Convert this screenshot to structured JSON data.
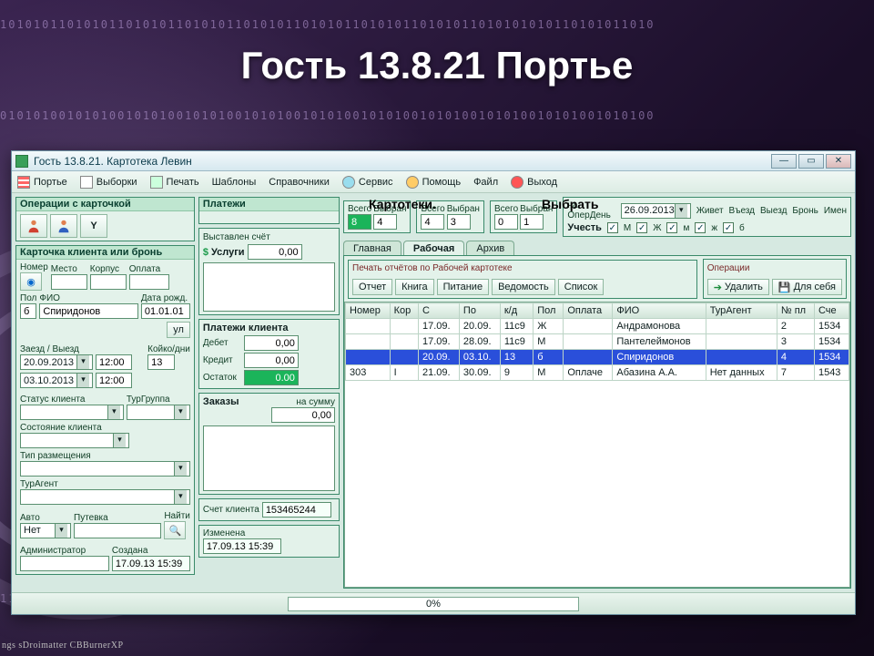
{
  "slide_title": "Гость 13.8.21 Портье",
  "window_title": "Гость 13.8.21. Картотека Левин",
  "menu": {
    "porte": "Портье",
    "vybor": "Выборки",
    "print": "Печать",
    "tmpl": "Шаблоны",
    "dir": "Справочники",
    "serv": "Сервис",
    "help": "Помощь",
    "file": "Файл",
    "exit": "Выход"
  },
  "overlay": {
    "karto": "Картотеки.",
    "choose": "Выбрать"
  },
  "ops_card_caption": "Операции с карточкой",
  "client_card_caption": "Карточка клиента или бронь",
  "payments_caption": "Платежи",
  "card": {
    "nomer": "Номер",
    "mesto": "Место",
    "korpus": "Корпус",
    "oplata": "Оплата",
    "pol": "Пол",
    "fio": "ФИО",
    "dob": "Дата рожд.",
    "pol_val": "б",
    "fio_val": "Спиридонов",
    "dob_val": "01.01.01",
    "zaezd": "Заезд / Выезд",
    "koiko": "Койко/дни",
    "zaezd_date": "20.09.2013",
    "zaezd_time": "12:00",
    "vyezd_date": "03.10.2013",
    "vyezd_time": "12:00",
    "koiko_val": "13",
    "status": "Статус клиента",
    "turg": "ТурГруппа",
    "sost": "Состояние клиента",
    "tip": "Тип размещения",
    "agent": "ТурАгент",
    "avto": "Авто",
    "put": "Путевка",
    "find": "Найти",
    "avto_val": "Нет",
    "admin": "Администратор",
    "created": "Создана",
    "created_val": "17.09.13 15:39",
    "changed": "Изменена",
    "changed_val": "17.09.13 15:39"
  },
  "pay": {
    "bill": "Выставлен счёт",
    "uslugi": "Услуги",
    "uslugi_val": "0,00",
    "client": "Платежи клиента",
    "debet": "Дебет",
    "debet_val": "0,00",
    "kredit": "Кредит",
    "kredit_val": "0,00",
    "ost": "Остаток",
    "ost_val": "0.00",
    "orders": "Заказы",
    "sum": "на сумму",
    "sum_val": "0,00",
    "acct": "Счет клиента",
    "acct_val": "153465244"
  },
  "right": {
    "vsego": "Всего",
    "vybran": "Выбран",
    "vsego1": "8",
    "vybran1": "4",
    "vsego2": "4",
    "vybran2": "3",
    "vsego3": "0",
    "vybran3": "1",
    "operday": "на ОперДень",
    "operday_val": "26.09.2013",
    "jivet": "Живет",
    "vezd": "Въезд",
    "vyezd": "Выезд",
    "bron": "Бронь",
    "imen": "Имен",
    "uchest": "Учесть",
    "f_M": "М",
    "f_J": "Ж",
    "f_m2": "м",
    "f_j2": "ж",
    "f_b": "б"
  },
  "tabs": {
    "main": "Главная",
    "work": "Рабочая",
    "arch": "Архив"
  },
  "print_group": "Печать отчётов по Рабочей картотеке",
  "ops_group": "Операции",
  "buttons": {
    "otchet": "Отчет",
    "kniga": "Книга",
    "pit": "Питание",
    "ved": "Ведомость",
    "spisok": "Список",
    "del": "Удалить",
    "self": "Для себя"
  },
  "cols": {
    "nomer": "Номер",
    "kor": "Кор",
    "s": "С",
    "po": "По",
    "kd": "к/д",
    "pol": "Пол",
    "oplata": "Оплата",
    "fio": "ФИО",
    "agent": "ТурАгент",
    "npl": "№ пл",
    "sch": "Сче"
  },
  "rows": [
    {
      "nomer": "",
      "kor": "",
      "s": "17.09.",
      "po": "20.09.",
      "kd": "11с9",
      "pol": "Ж",
      "oplata": "",
      "fio": "Андрамонова",
      "agent": "",
      "npl": "2",
      "sch": "1534"
    },
    {
      "nomer": "",
      "kor": "",
      "s": "17.09.",
      "po": "28.09.",
      "kd": "11с9",
      "pol": "М",
      "oplata": "",
      "fio": "Пантелеймонов",
      "agent": "",
      "npl": "3",
      "sch": "1534"
    },
    {
      "nomer": "",
      "kor": "",
      "s": "20.09.",
      "po": "03.10.",
      "kd": "13",
      "pol": "б",
      "oplata": "",
      "fio": "Спиридонов",
      "agent": "",
      "npl": "4",
      "sch": "1534"
    },
    {
      "nomer": "303",
      "kor": "I",
      "s": "21.09.",
      "po": "30.09.",
      "kd": "9",
      "pol": "М",
      "oplata": "Оплаче",
      "fio": "Абазина А.А.",
      "agent": "Нет данных",
      "npl": "7",
      "sch": "1543"
    }
  ],
  "progress": "0%",
  "task_hint": "ngs   sDroimatter  CBBurnerXP",
  "btn_ул": "ул"
}
